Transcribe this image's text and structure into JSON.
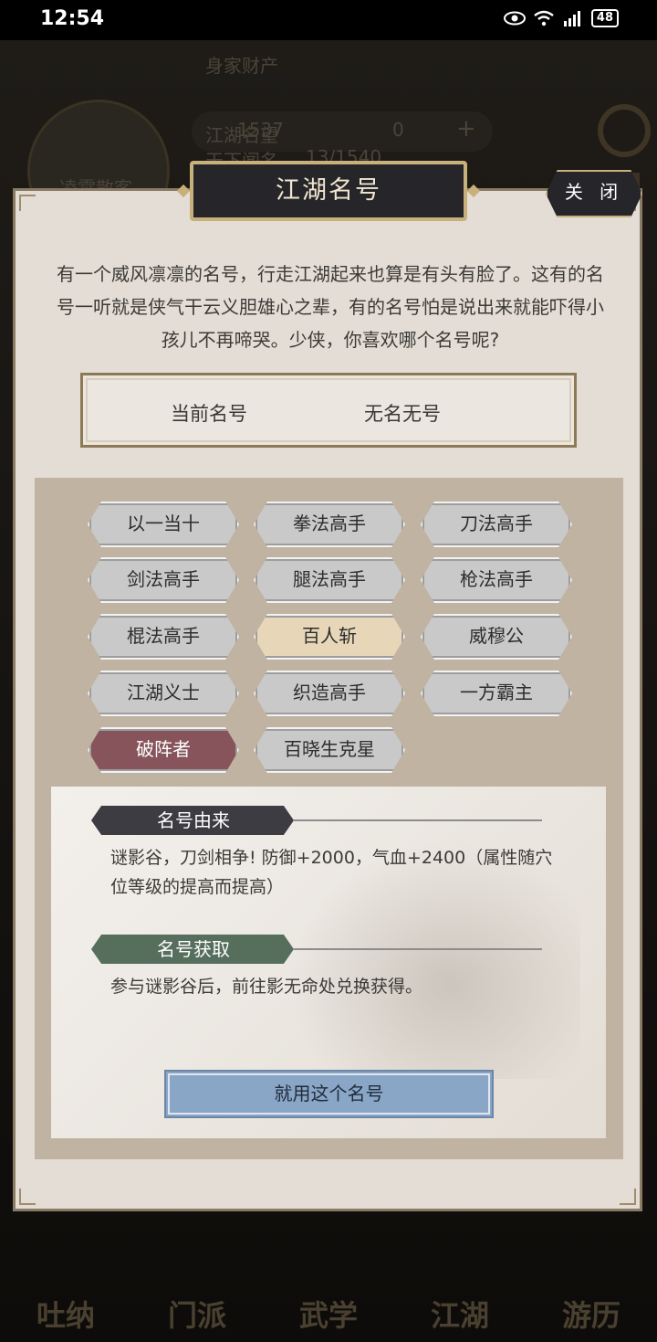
{
  "status_bar": {
    "time": "12:54",
    "battery": "48"
  },
  "background": {
    "wealth_label": "身家财产",
    "coins": "1537",
    "gems": "0",
    "fame_label": "江湖名望",
    "fame_rank": "天下闻名",
    "fame_value": "13/1540",
    "name_plate": "凌霄散客",
    "nav": [
      "吐纳",
      "门派",
      "武学",
      "江湖",
      "游历"
    ]
  },
  "dialog": {
    "title": "江湖名号",
    "close_label": "关 闭",
    "intro": "有一个威风凛凛的名号，行走江湖起来也算是有头有脸了。这有的名号一听就是侠气干云义胆雄心之辈，有的名号怕是说出来就能吓得小孩儿不再啼哭。少侠，你喜欢哪个名号呢?",
    "current_label": "当前名号",
    "current_value": "无名无号",
    "titles": [
      "以一当十",
      "拳法高手",
      "刀法高手",
      "剑法高手",
      "腿法高手",
      "枪法高手",
      "棍法高手",
      "百人斩",
      "威穆公",
      "江湖义士",
      "织造高手",
      "一方霸主",
      "破阵者",
      "百晓生克星"
    ],
    "selected_title": "破阵者",
    "origin_heading": "名号由来",
    "origin_text": "谜影谷，刀剑相争! 防御+2000，气血+2400（属性随穴位等级的提高而提高）",
    "obtain_heading": "名号获取",
    "obtain_text": "参与谜影谷后，前往影无命处兑换获得。",
    "use_button": "就用这个名号"
  },
  "colors": {
    "selected": "#86545a",
    "golden": "#e7d7b8",
    "normal": "#c9c9c9",
    "use_button": "#8aa6c6"
  }
}
